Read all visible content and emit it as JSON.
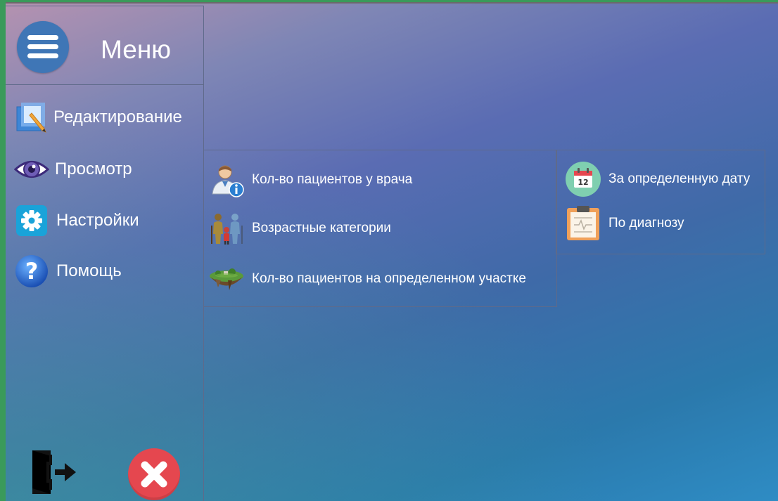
{
  "menu": {
    "title": "Меню"
  },
  "sidebar": {
    "items": [
      {
        "label": "Редактирование",
        "icon": "edit-icon"
      },
      {
        "label": "Просмотр",
        "icon": "eye-icon"
      },
      {
        "label": "Настройки",
        "icon": "gear-icon"
      },
      {
        "label": "Помощь",
        "icon": "help-icon"
      }
    ],
    "bottom": {
      "exit_icon": "exit-icon",
      "close_icon": "close-icon"
    }
  },
  "submenu_view": {
    "items": [
      {
        "label": "Кол-во пациентов у врача",
        "icon": "doctor-info-icon"
      },
      {
        "label": "Возрастные категории",
        "icon": "family-icon"
      },
      {
        "label": "Кол-во пациентов на определенном участке",
        "icon": "island-icon"
      }
    ]
  },
  "submenu_date": {
    "items": [
      {
        "label": "За определенную дату",
        "icon": "calendar-icon"
      },
      {
        "label": "По диагнозу",
        "icon": "clipboard-icon"
      }
    ]
  },
  "colors": {
    "menu_button": "#3f76b6",
    "close_button": "#e5474f",
    "gear_bg": "#1aa3d9"
  }
}
